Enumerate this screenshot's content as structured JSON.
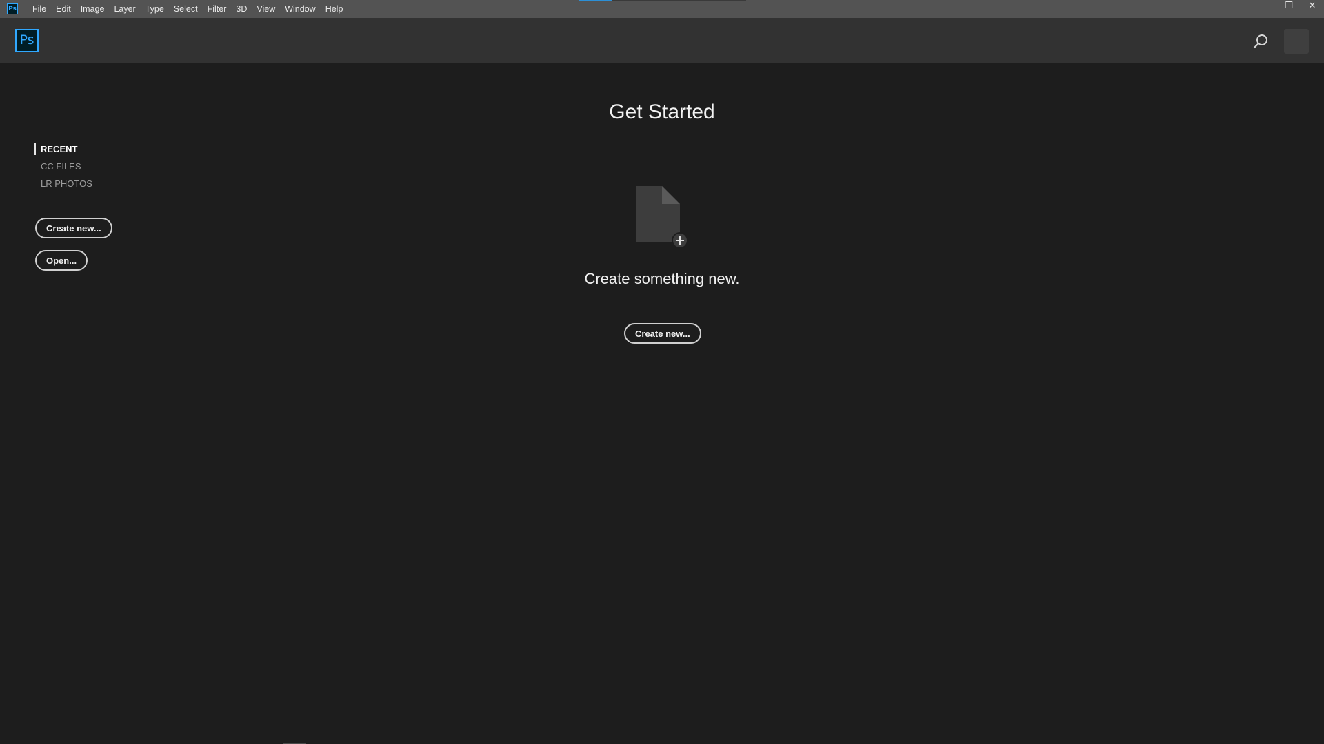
{
  "app": {
    "mini_icon_text": "Ps",
    "logo_text": "Ps",
    "accent_color": "#31a8ff"
  },
  "menubar": {
    "items": [
      "File",
      "Edit",
      "Image",
      "Layer",
      "Type",
      "Select",
      "Filter",
      "3D",
      "View",
      "Window",
      "Help"
    ]
  },
  "window_controls": {
    "minimize": "—",
    "restore": "❐",
    "close": "✕"
  },
  "header": {
    "search_icon": "search-icon",
    "avatar": "user-avatar"
  },
  "sidebar": {
    "nav": [
      {
        "label": "RECENT",
        "active": true
      },
      {
        "label": "CC FILES",
        "active": false
      },
      {
        "label": "LR PHOTOS",
        "active": false
      }
    ],
    "create_label": "Create new...",
    "open_label": "Open..."
  },
  "main": {
    "title": "Get Started",
    "icon": "new-file-icon",
    "tagline": "Create something new.",
    "create_label": "Create new..."
  }
}
